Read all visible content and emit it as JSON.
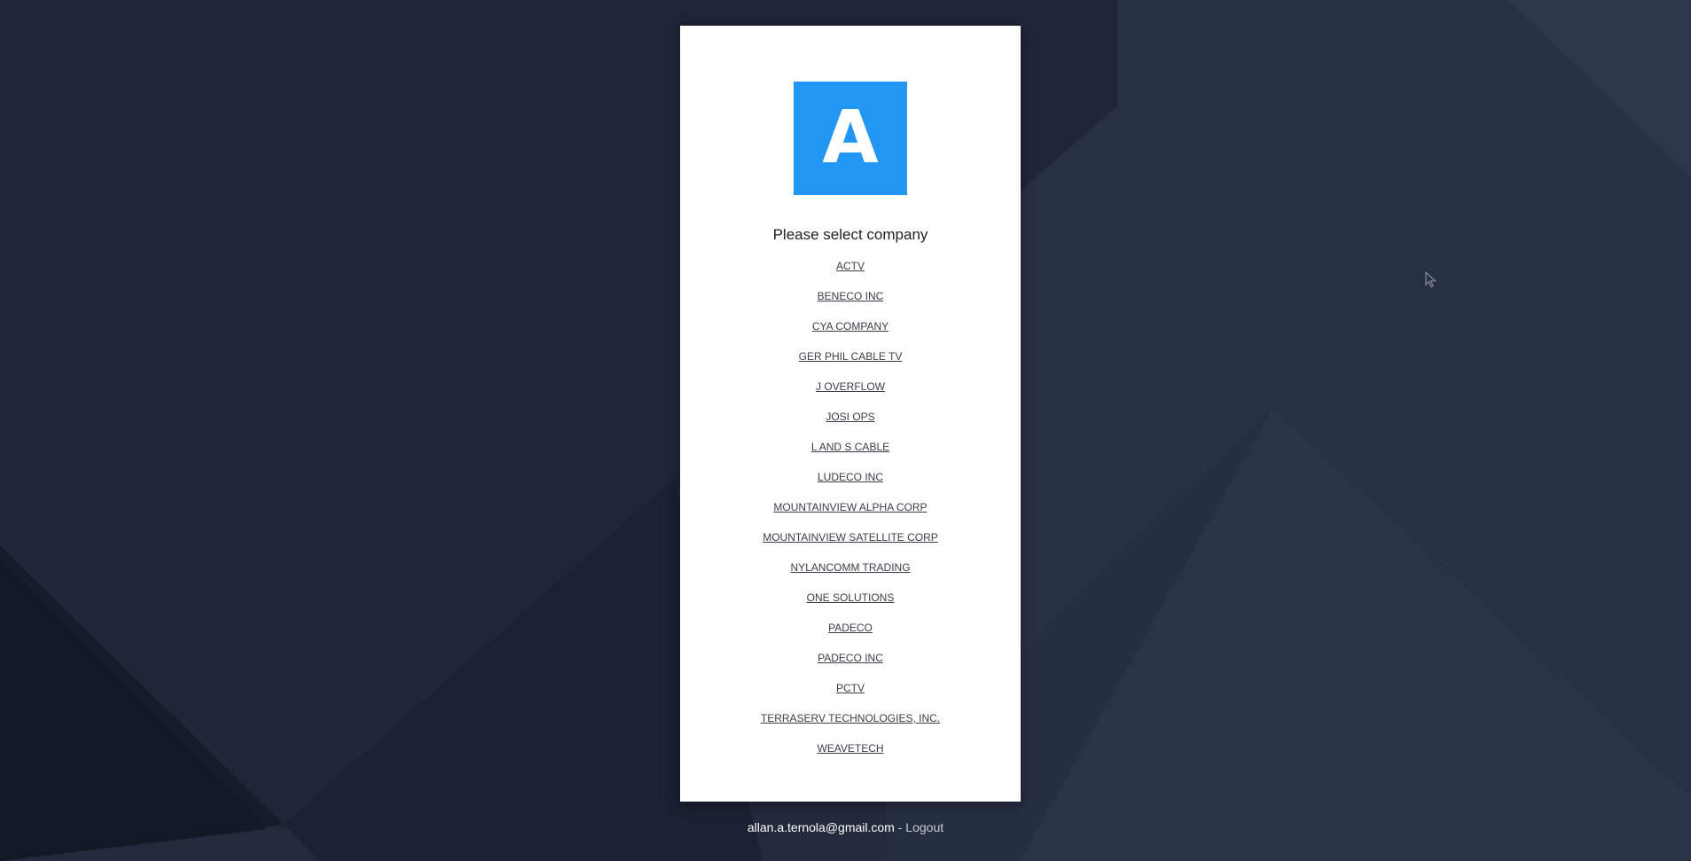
{
  "logo": {
    "letter": "A",
    "color": "#2196f3"
  },
  "heading": "Please select company",
  "companies": [
    "ACTV",
    "BENECO INC",
    "CYA COMPANY",
    "GER PHIL CABLE TV",
    "J OVERFLOW",
    "JOSI OPS",
    "L AND S CABLE",
    "LUDECO INC",
    "MOUNTAINVIEW ALPHA CORP",
    "MOUNTAINVIEW SATELLITE CORP",
    "NYLANCOMM TRADING",
    "ONE SOLUTIONS",
    "PADECO",
    "PADECO INC",
    "PCTV",
    "TERRASERV TECHNOLOGIES, INC.",
    "WEAVETECH"
  ],
  "footer": {
    "email": "allan.a.ternola@gmail.com",
    "separator": " - ",
    "logout": "Logout"
  },
  "colors": {
    "background": "#232a3d",
    "card": "#ffffff"
  }
}
